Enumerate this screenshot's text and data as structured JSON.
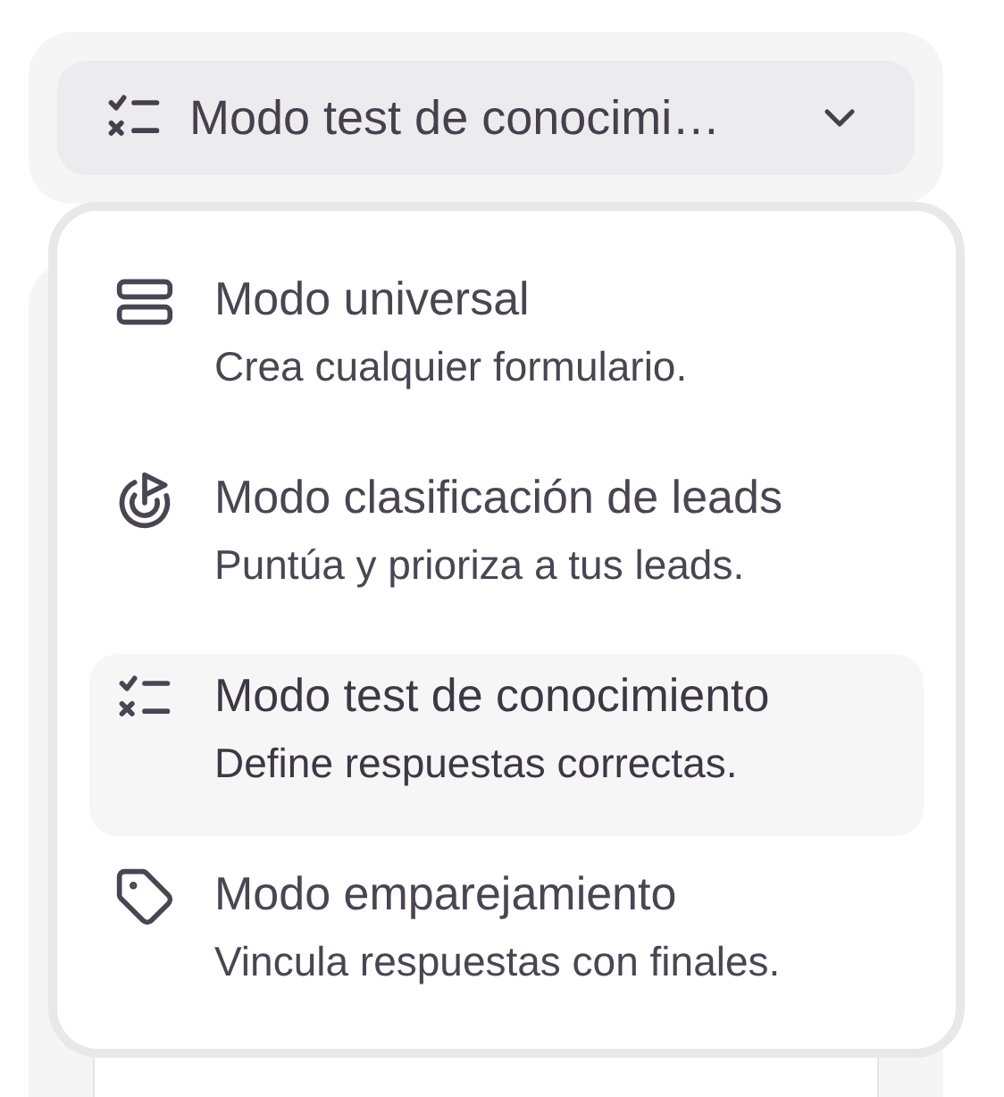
{
  "mode_select": {
    "value": "Modo test de conocimi…",
    "kind": "checklist"
  },
  "menu": {
    "items": [
      {
        "kind": "rows",
        "title": "Modo universal",
        "description": "Crea cualquier formulario.",
        "selected": false
      },
      {
        "kind": "target",
        "title": "Modo clasificación de leads",
        "description": "Puntúa y prioriza a tus leads.",
        "selected": false
      },
      {
        "kind": "checklist",
        "title": "Modo test de conocimiento",
        "description": "Define respuestas correctas.",
        "selected": true
      },
      {
        "kind": "tag",
        "title": "Modo emparejamiento",
        "description": "Vincula respuestas con finales.",
        "selected": false
      }
    ]
  }
}
